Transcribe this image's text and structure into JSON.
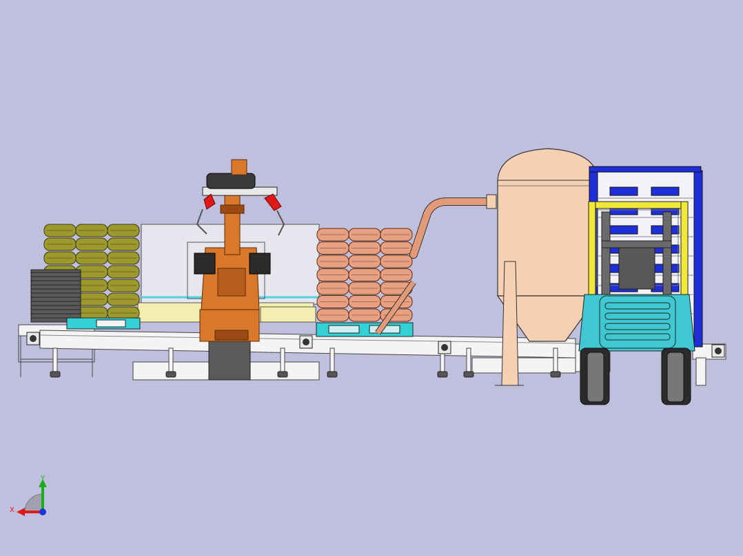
{
  "viewport": {
    "background": "#c0c0de"
  },
  "triad": {
    "x_label": "X",
    "y_label": "Y"
  },
  "colors": {
    "robot": "#d9782a",
    "robot_dark": "#9a4a12",
    "bag_olive": "#9c9a2e",
    "bag_salmon": "#e8a083",
    "tank": "#f6d0b2",
    "pipe": "#e29a78",
    "pallet_cyan": "#33d0d6",
    "forklift_body": "#3fc8d2",
    "forklift_mast": "#f2e83a",
    "rack_blue": "#1e2fd8",
    "conveyor": "#f4f4f4",
    "outline": "#2a2a2a",
    "accent_red": "#e01818",
    "axis_x": "#e01818",
    "axis_y": "#18b018",
    "axis_z": "#1838d8"
  }
}
